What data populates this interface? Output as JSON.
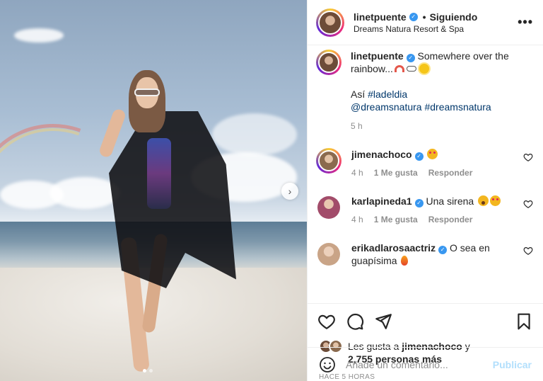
{
  "post": {
    "author": "linetpuente",
    "separator": "•",
    "follow_status": "Siguiendo",
    "location": "Dreams Natura Resort & Spa",
    "more_icon": "more-horizontal-icon",
    "next_icon": "chevron-right-icon",
    "carousel_count": 2,
    "carousel_index": 0
  },
  "caption": {
    "username": "linetpuente",
    "text": " Somewhere over the rainbow...",
    "line2_prefix": "Así ",
    "hashtag1": "#ladeldia",
    "mention": "@dreamsnatura",
    "hashtag2": "#dreamsnatura",
    "time": "5 h"
  },
  "comments": [
    {
      "username": "jimenachoco",
      "text": "",
      "time": "4 h",
      "likes": "1 Me gusta",
      "reply": "Responder",
      "avatar_color": "#b48a6a"
    },
    {
      "username": "karlapineda1",
      "text": " Una sirena ",
      "time": "4 h",
      "likes": "1 Me gusta",
      "reply": "Responder",
      "avatar_color": "#a24c6a"
    },
    {
      "username": "erikadlarosaactriz",
      "text": " O sea en guapísima ",
      "time": "",
      "likes": "",
      "reply": "",
      "avatar_color": "#c9a487"
    }
  ],
  "likes": {
    "prefix": "Les gusta a ",
    "user": "jimenachoco",
    "suffix": " y",
    "count_text": "2,755 personas más"
  },
  "timestamp": "HACE 5 HORAS",
  "add_comment": {
    "placeholder": "Añade un comentario...",
    "publish_label": "Publicar"
  },
  "colors": {
    "verified": "#3897f0",
    "link": "#00376b",
    "muted": "#8e8e8e",
    "publish_disabled": "#b2dffc"
  }
}
